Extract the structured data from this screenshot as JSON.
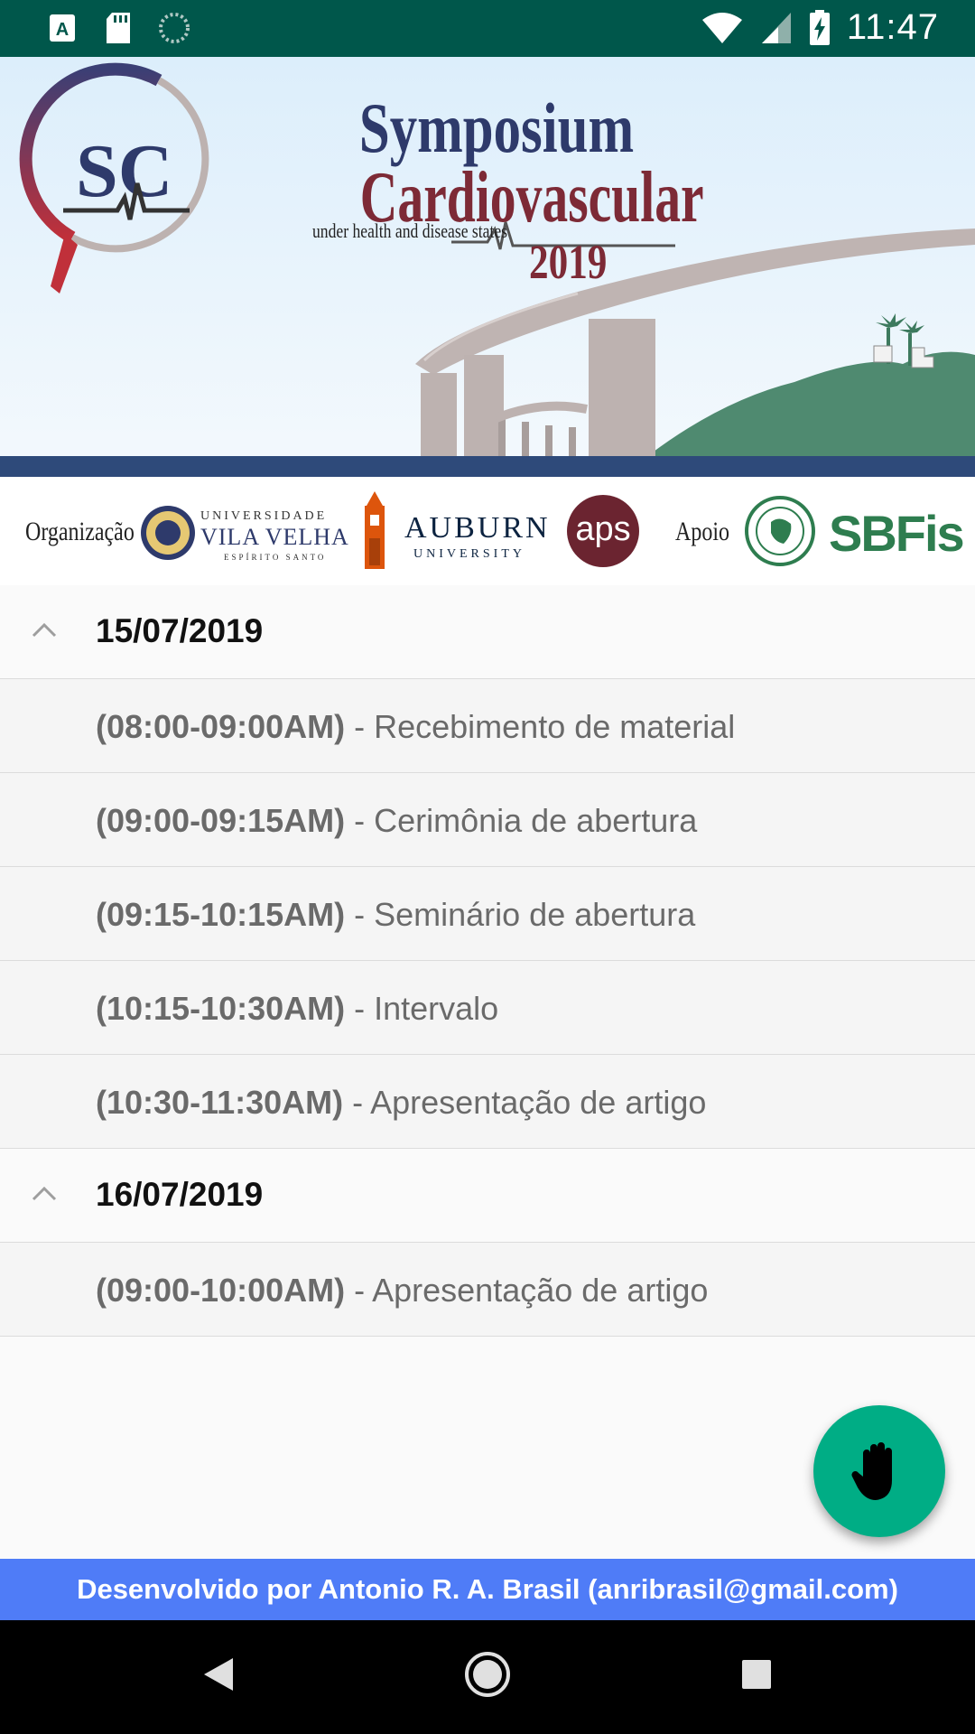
{
  "status_bar": {
    "time": "11:47",
    "icons": [
      "a-icon",
      "sd-card-icon",
      "sync-icon",
      "wifi-icon",
      "signal-icon",
      "battery-charging-icon"
    ]
  },
  "banner": {
    "title_line1": "Symposium",
    "title_line2": "Cardiovascular",
    "subtitle": "under health and disease states",
    "year": "2019",
    "logo_letters": "SC"
  },
  "sponsors": {
    "organization_label": "Organização",
    "uvv_top": "UNIVERSIDADE",
    "uvv_name": "VILA VELHA",
    "uvv_state": "ESPÍRITO SANTO",
    "auburn_name": "AUBURN",
    "auburn_sub": "UNIVERSITY",
    "aps_logo": "aps",
    "support_label": "Apoio",
    "sbfis": "SBFis"
  },
  "schedule": [
    {
      "date": "15/07/2019",
      "items": [
        {
          "time": "(08:00-09:00AM)",
          "title": " - Recebimento de material"
        },
        {
          "time": "(09:00-09:15AM)",
          "title": " - Cerimônia de abertura"
        },
        {
          "time": "(09:15-10:15AM)",
          "title": " - Seminário de abertura"
        },
        {
          "time": "(10:15-10:30AM)",
          "title": " - Intervalo"
        },
        {
          "time": "(10:30-11:30AM)",
          "title": " - Apresentação de artigo"
        }
      ]
    },
    {
      "date": "16/07/2019",
      "items": [
        {
          "time": "(09:00-10:00AM)",
          "title": " - Apresentação de artigo"
        }
      ]
    }
  ],
  "fab": {
    "icon": "hand-raise-icon"
  },
  "footer": {
    "text": "Desenvolvido por Antonio R. A. Brasil (anribrasil@gmail.com)"
  },
  "colors": {
    "status_bar": "#00574b",
    "fab": "#00ad85",
    "footer": "#4f7cf7",
    "title_blue": "#2e3a6b",
    "title_red": "#7d2a36"
  }
}
